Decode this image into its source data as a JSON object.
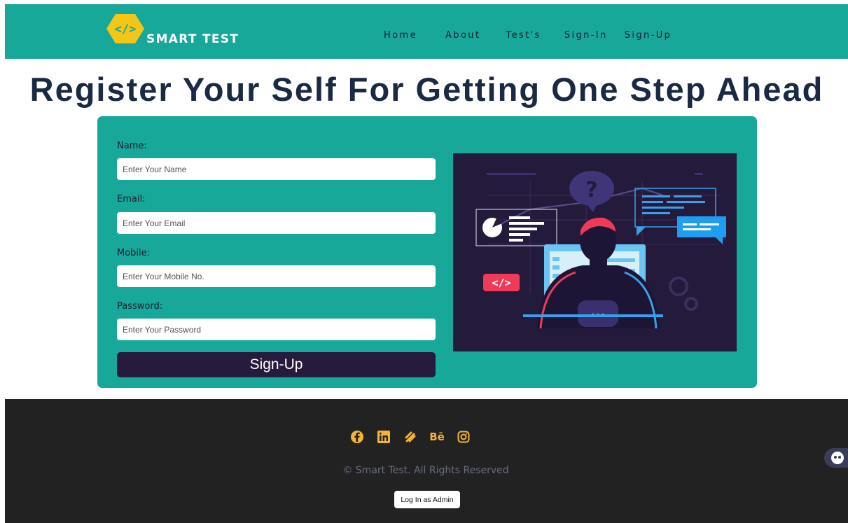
{
  "brand": {
    "name": "SMART TEST",
    "logo_glyph": "</>",
    "color_logo": "#f5c518"
  },
  "nav": {
    "items": [
      {
        "label": "Home"
      },
      {
        "label": "About"
      },
      {
        "label": "Test's"
      },
      {
        "label": "Sign-In"
      },
      {
        "label": "Sign-Up"
      }
    ]
  },
  "page": {
    "title": "Register Your Self For Getting One Step Ahead"
  },
  "form": {
    "name_label": "Name:",
    "name_placeholder": "Enter Your Name",
    "email_label": "Email:",
    "email_placeholder": "Enter Your Email",
    "mobile_label": "Mobile:",
    "mobile_placeholder": "Enter Your Mobile No.",
    "password_label": "Password:",
    "password_placeholder": "Enter Your Password",
    "submit_label": "Sign-Up"
  },
  "illustration": {
    "code_tag": "</>",
    "question_mark": "?",
    "dots": "•••"
  },
  "footer": {
    "social_icons": [
      "facebook-icon",
      "linkedin-icon",
      "squarespace-icon",
      "behance-icon",
      "instagram-icon"
    ],
    "behance_text": "Bē",
    "copyright": "© Smart Test. All Rights Reserved",
    "admin_button": "Log In as Admin"
  },
  "colors": {
    "teal": "#17a89a",
    "dark_purple": "#261a3d",
    "heading": "#1b2a44",
    "footer_bg": "#222222",
    "icon_yellow": "#f2b632"
  }
}
